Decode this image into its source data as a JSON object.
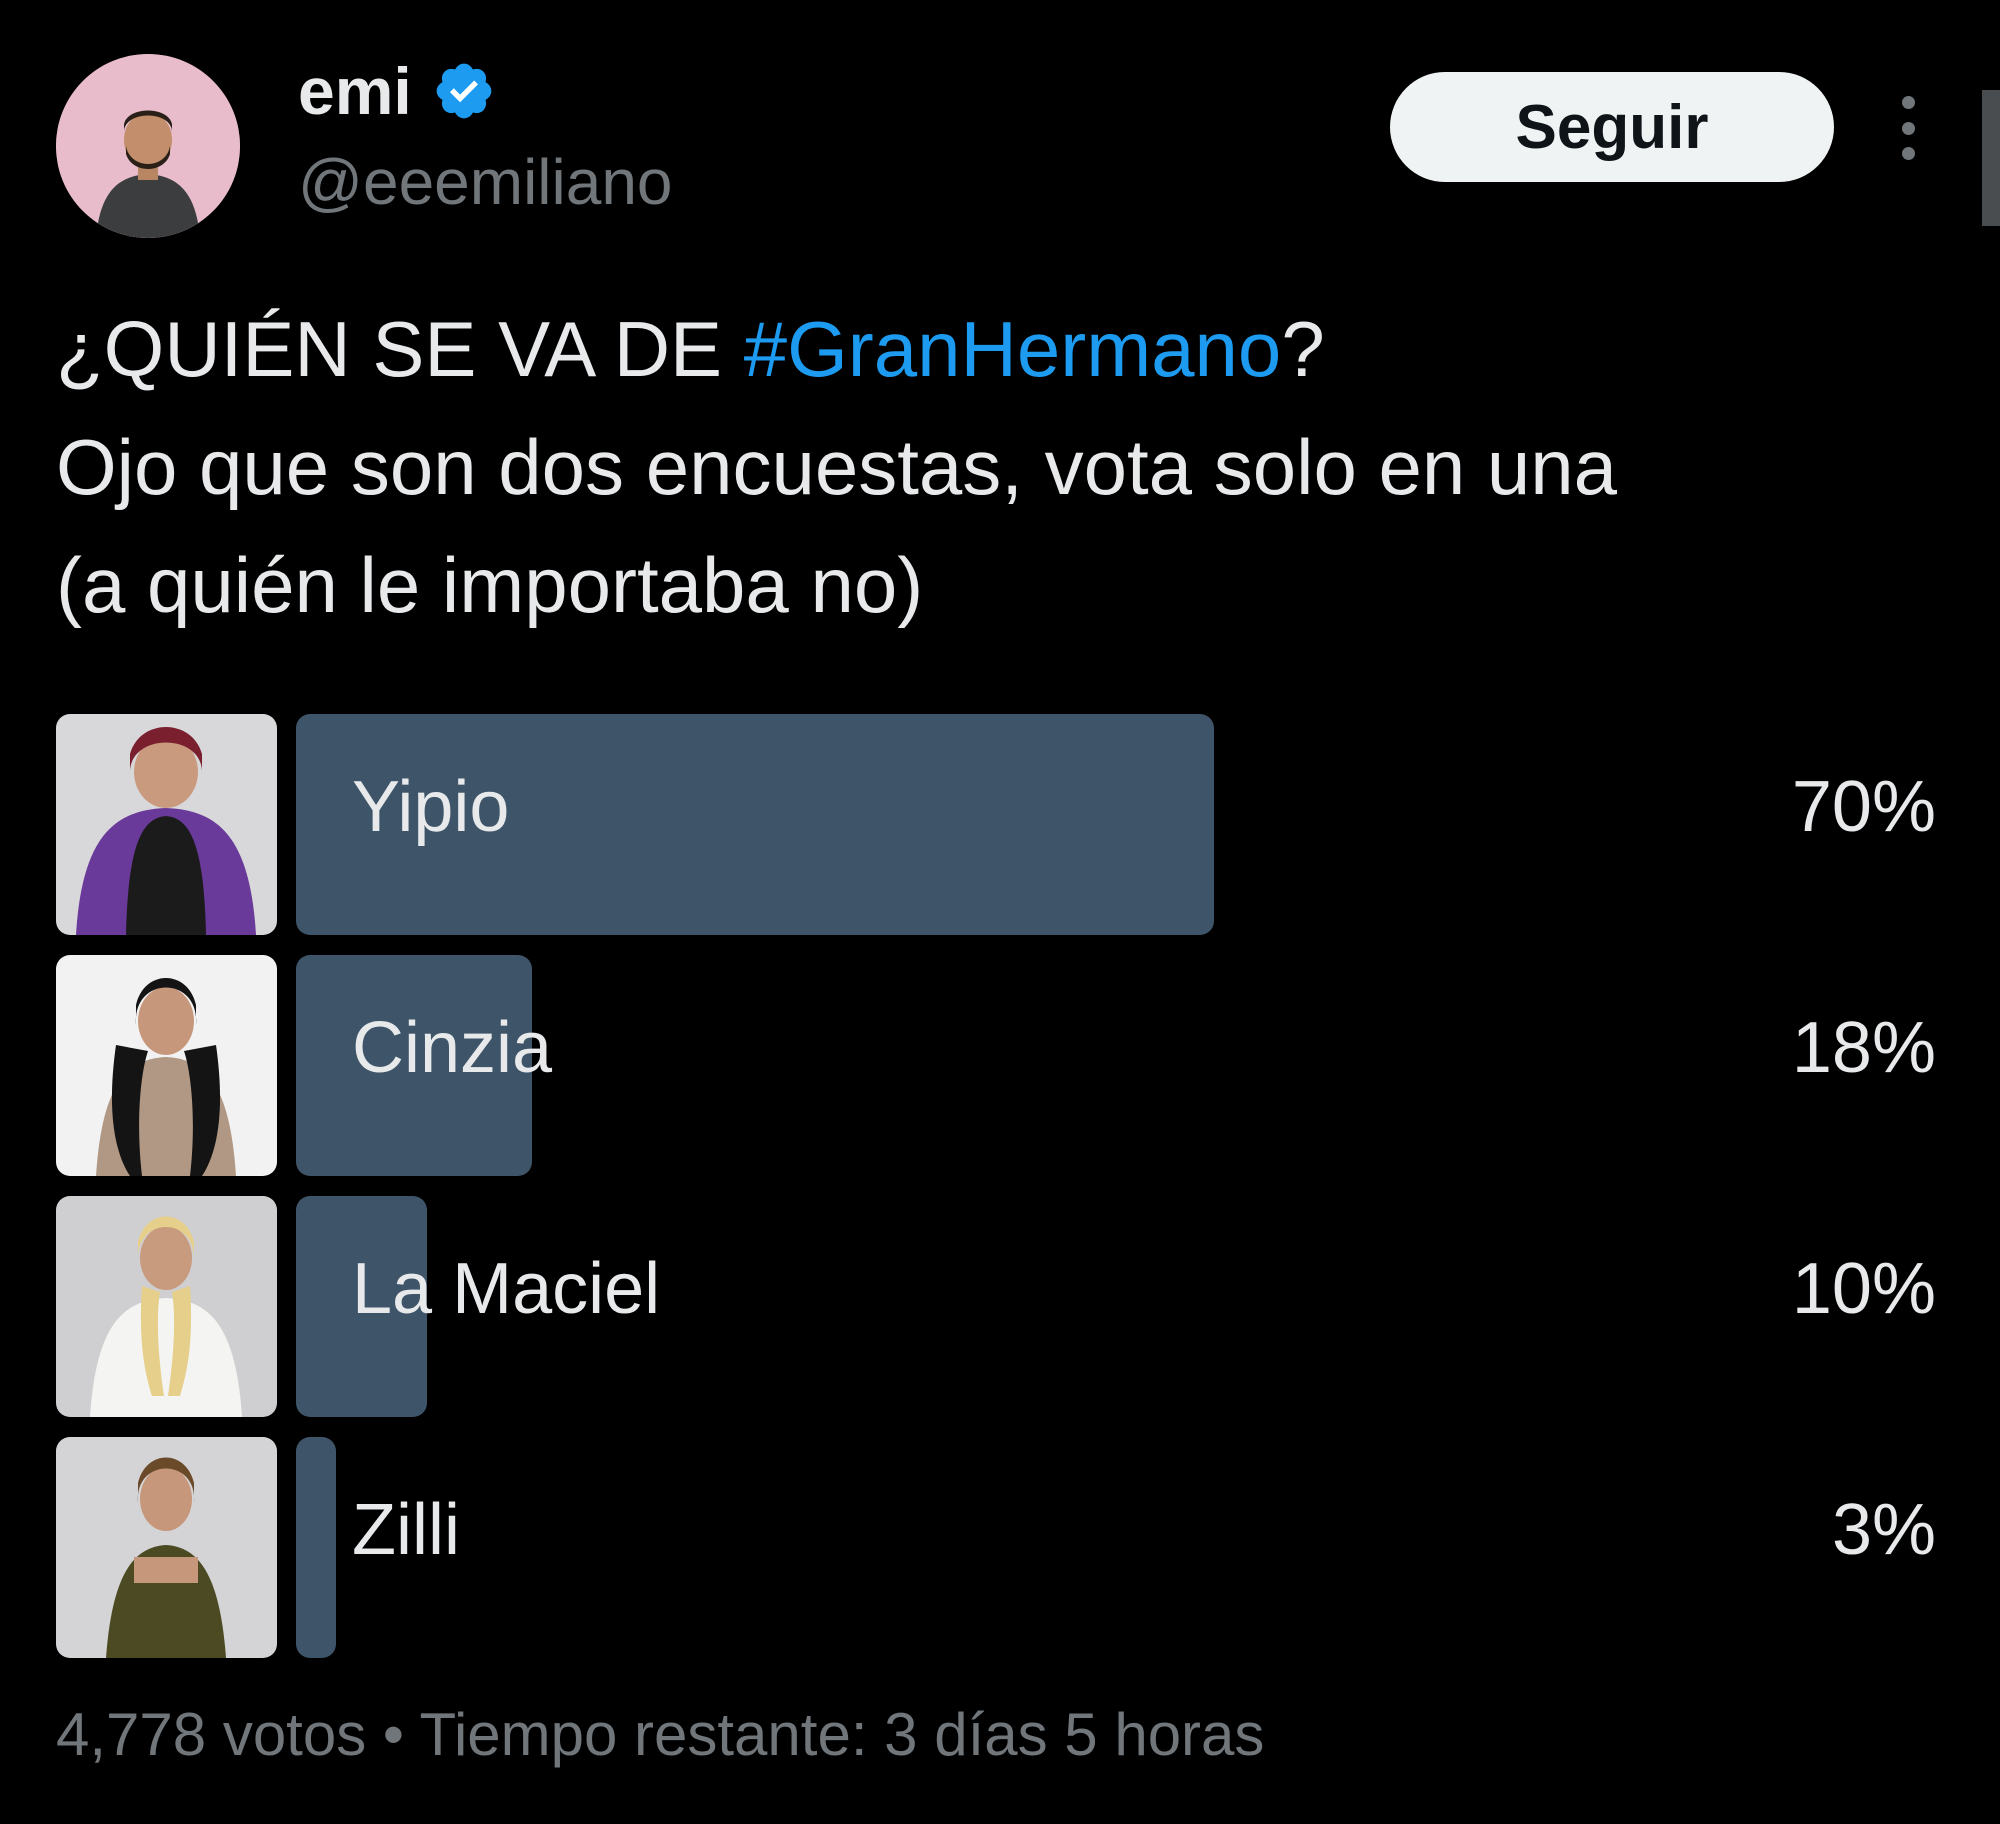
{
  "author": {
    "display_name": "emi",
    "handle": "@eeemiliano",
    "verified_icon": "verified-badge-icon",
    "verified_color": "#1d9bf0"
  },
  "header": {
    "follow_label": "Seguir",
    "more_icon": "more-vertical-icon"
  },
  "tweet": {
    "line1_prefix": "¿QUIÉN SE VA DE ",
    "hashtag": "#GranHermano",
    "line1_suffix": "?",
    "line2": "Ojo que son dos encuestas, vota solo en una",
    "line3": "(a quién le importaba no)",
    "hashtag_color": "#1d9bf0"
  },
  "poll": {
    "bar_color": "#3e5468",
    "options": [
      {
        "label": "Yipio",
        "percent_label": "70%",
        "share": 0.7
      },
      {
        "label": "Cinzia",
        "percent_label": "18%",
        "share": 0.18
      },
      {
        "label": "La Maciel",
        "percent_label": "10%",
        "share": 0.1
      },
      {
        "label": "Zilli",
        "percent_label": "3%",
        "share": 0.03
      }
    ],
    "votes": "4,778 votos",
    "separator": "•",
    "time_left": "Tiempo restante: 3 días 5 horas"
  }
}
